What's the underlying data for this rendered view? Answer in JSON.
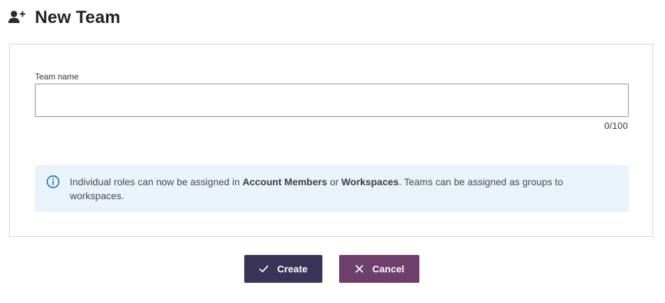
{
  "header": {
    "title": "New Team",
    "icon": "user-plus-icon"
  },
  "form": {
    "team_name_label": "Team name",
    "team_name_value": "",
    "team_name_placeholder": "",
    "char_counter": "0/100"
  },
  "info": {
    "icon": "info-icon",
    "text_before": "Individual roles can now be assigned in ",
    "link_account_members": "Account Members",
    "text_or": " or ",
    "link_workspaces": "Workspaces",
    "text_after": ". Teams can be assigned as groups to workspaces."
  },
  "actions": {
    "create_label": "Create",
    "create_icon": "check-icon",
    "cancel_label": "Cancel",
    "cancel_icon": "close-icon"
  },
  "colors": {
    "create_button": "#3a3458",
    "cancel_button": "#6e3f6a",
    "info_background": "#e9f3fa",
    "info_icon": "#2b7bbd"
  }
}
